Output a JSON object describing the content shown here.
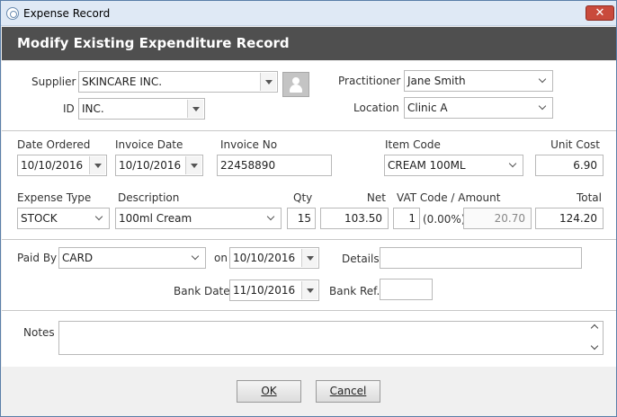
{
  "window": {
    "title": "Expense Record",
    "close_glyph": "✕"
  },
  "header": {
    "title": "Modify Existing Expenditure Record"
  },
  "supplier_section": {
    "supplier_label": "Supplier",
    "supplier_value": "SKINCARE INC.",
    "id_label": "ID",
    "id_value": "INC.",
    "practitioner_label": "Practitioner",
    "practitioner_value": "Jane Smith",
    "location_label": "Location",
    "location_value": "Clinic A"
  },
  "order_section": {
    "date_ordered_label": "Date Ordered",
    "date_ordered_value": "10/10/2016",
    "invoice_date_label": "Invoice Date",
    "invoice_date_value": "10/10/2016",
    "invoice_no_label": "Invoice No",
    "invoice_no_value": "22458890",
    "item_code_label": "Item Code",
    "item_code_value": "CREAM 100ML",
    "unit_cost_label": "Unit Cost",
    "unit_cost_value": "6.90",
    "expense_type_label": "Expense Type",
    "expense_type_value": "STOCK",
    "description_label": "Description",
    "description_value": "100ml Cream",
    "qty_label": "Qty",
    "qty_value": "15",
    "net_label": "Net",
    "net_value": "103.50",
    "vat_label": "VAT Code / Amount",
    "vat_code_value": "1",
    "vat_percent": "(0.00%)",
    "vat_amount_value": "20.70",
    "total_label": "Total",
    "total_value": "124.20"
  },
  "payment_section": {
    "paid_by_label": "Paid By",
    "paid_by_value": "CARD",
    "on_label": "on",
    "on_date_value": "10/10/2016",
    "details_label": "Details",
    "details_value": "",
    "bank_date_label": "Bank Date",
    "bank_date_value": "11/10/2016",
    "bank_ref_label": "Bank Ref.",
    "bank_ref_value": ""
  },
  "notes_section": {
    "notes_label": "Notes",
    "notes_value": ""
  },
  "footer": {
    "ok_label": "OK",
    "cancel_label": "Cancel"
  }
}
